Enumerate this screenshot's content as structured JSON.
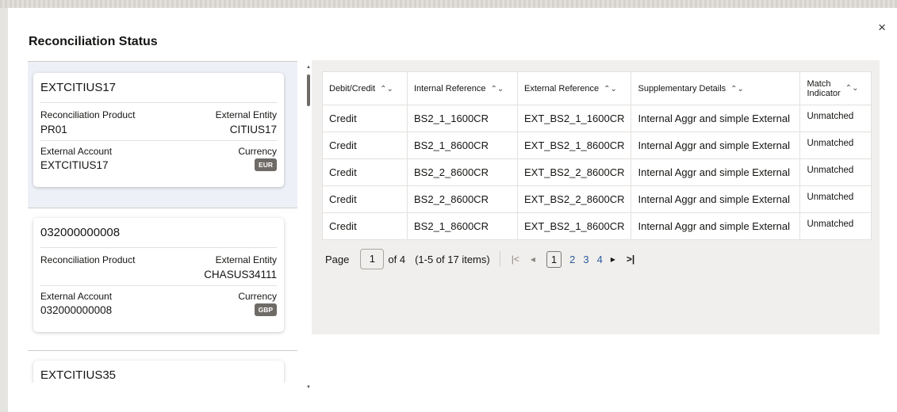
{
  "dialog": {
    "title": "Reconciliation Status",
    "close_icon": "×"
  },
  "list": {
    "items": [
      {
        "title": "EXTCITIUS17",
        "product_label": "Reconciliation Product",
        "product_value": "PR01",
        "entity_label": "External Entity",
        "entity_value": "CITIUS17",
        "account_label": "External Account",
        "account_value": "EXTCITIUS17",
        "currency_label": "Currency",
        "currency_value": "EUR"
      },
      {
        "title": "032000000008",
        "product_label": "Reconciliation Product",
        "product_value": "",
        "entity_label": "External Entity",
        "entity_value": "CHASUS34111",
        "account_label": "External Account",
        "account_value": "032000000008",
        "currency_label": "Currency",
        "currency_value": "GBP"
      },
      {
        "title": "EXTCITIUS35"
      }
    ]
  },
  "table": {
    "headers": [
      "Debit/Credit",
      "Internal Reference",
      "External Reference",
      "Supplementary Details",
      "Match",
      "Indicator"
    ],
    "sort_icon": "⌃⌄",
    "rows": [
      [
        "Credit",
        "BS2_1_1600CR",
        "EXT_BS2_1_1600CR",
        "Internal Aggr and simple External",
        "Unmatched"
      ],
      [
        "Credit",
        "BS2_1_8600CR",
        "EXT_BS2_1_8600CR",
        "Internal Aggr and simple External",
        "Unmatched"
      ],
      [
        "Credit",
        "BS2_2_8600CR",
        "EXT_BS2_2_8600CR",
        "Internal Aggr and simple External",
        "Unmatched"
      ],
      [
        "Credit",
        "BS2_2_8600CR",
        "EXT_BS2_2_8600CR",
        "Internal Aggr and simple External",
        "Unmatched"
      ],
      [
        "Credit",
        "BS2_1_8600CR",
        "EXT_BS2_1_8600CR",
        "Internal Aggr and simple External",
        "Unmatched"
      ]
    ]
  },
  "pager": {
    "page_label": "Page",
    "page_value": "1",
    "of_label": "of 4",
    "range": "(1-5 of 17 items)",
    "first": "|<",
    "prev": "◂",
    "pages": [
      "1",
      "2",
      "3",
      "4"
    ],
    "next": "▸",
    "last": ">|"
  }
}
